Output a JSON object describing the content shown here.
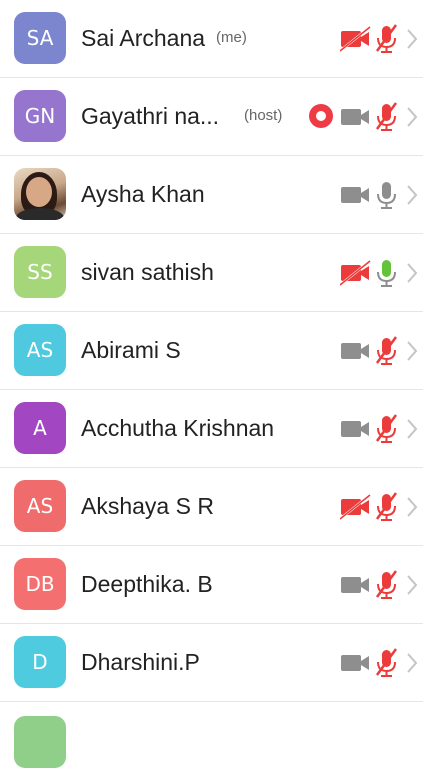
{
  "participants": [
    {
      "initials": "SA",
      "name": "Sai Archana",
      "tag": "(me)",
      "avatar_color": "#7b86cf",
      "video": "off",
      "mic": "muted",
      "recording": false
    },
    {
      "initials": "GN",
      "name": "Gayathri na...",
      "tag": "(host)",
      "avatar_color": "#9575cd",
      "video": "on",
      "mic": "muted",
      "recording": true
    },
    {
      "initials": "",
      "name": "Aysha Khan",
      "tag": "",
      "avatar_color": "",
      "video": "on",
      "mic": "on-gray",
      "recording": false,
      "photo": true
    },
    {
      "initials": "SS",
      "name": "sivan sathish",
      "tag": "",
      "avatar_color": "#a5d67a",
      "video": "off",
      "mic": "on-green",
      "recording": false
    },
    {
      "initials": "AS",
      "name": "Abirami S",
      "tag": "",
      "avatar_color": "#4fc9e0",
      "video": "on",
      "mic": "muted",
      "recording": false
    },
    {
      "initials": "A",
      "name": "Acchutha Krishnan",
      "tag": "",
      "avatar_color": "#a246c2",
      "video": "on",
      "mic": "muted",
      "recording": false
    },
    {
      "initials": "AS",
      "name": "Akshaya S R",
      "tag": "",
      "avatar_color": "#f06b6b",
      "video": "off",
      "mic": "muted",
      "recording": false
    },
    {
      "initials": "DB",
      "name": "Deepthika. B",
      "tag": "",
      "avatar_color": "#f47070",
      "video": "on",
      "mic": "muted",
      "recording": false
    },
    {
      "initials": "D",
      "name": "Dharshini.P",
      "tag": "",
      "avatar_color": "#4fcbe0",
      "video": "on",
      "mic": "muted",
      "recording": false
    }
  ],
  "colors": {
    "muted_red": "#ec3b3b",
    "icon_gray": "#8e8e8e",
    "mic_green": "#63c43a",
    "chevron": "#c4c4c4",
    "record": "#ef3b45"
  }
}
